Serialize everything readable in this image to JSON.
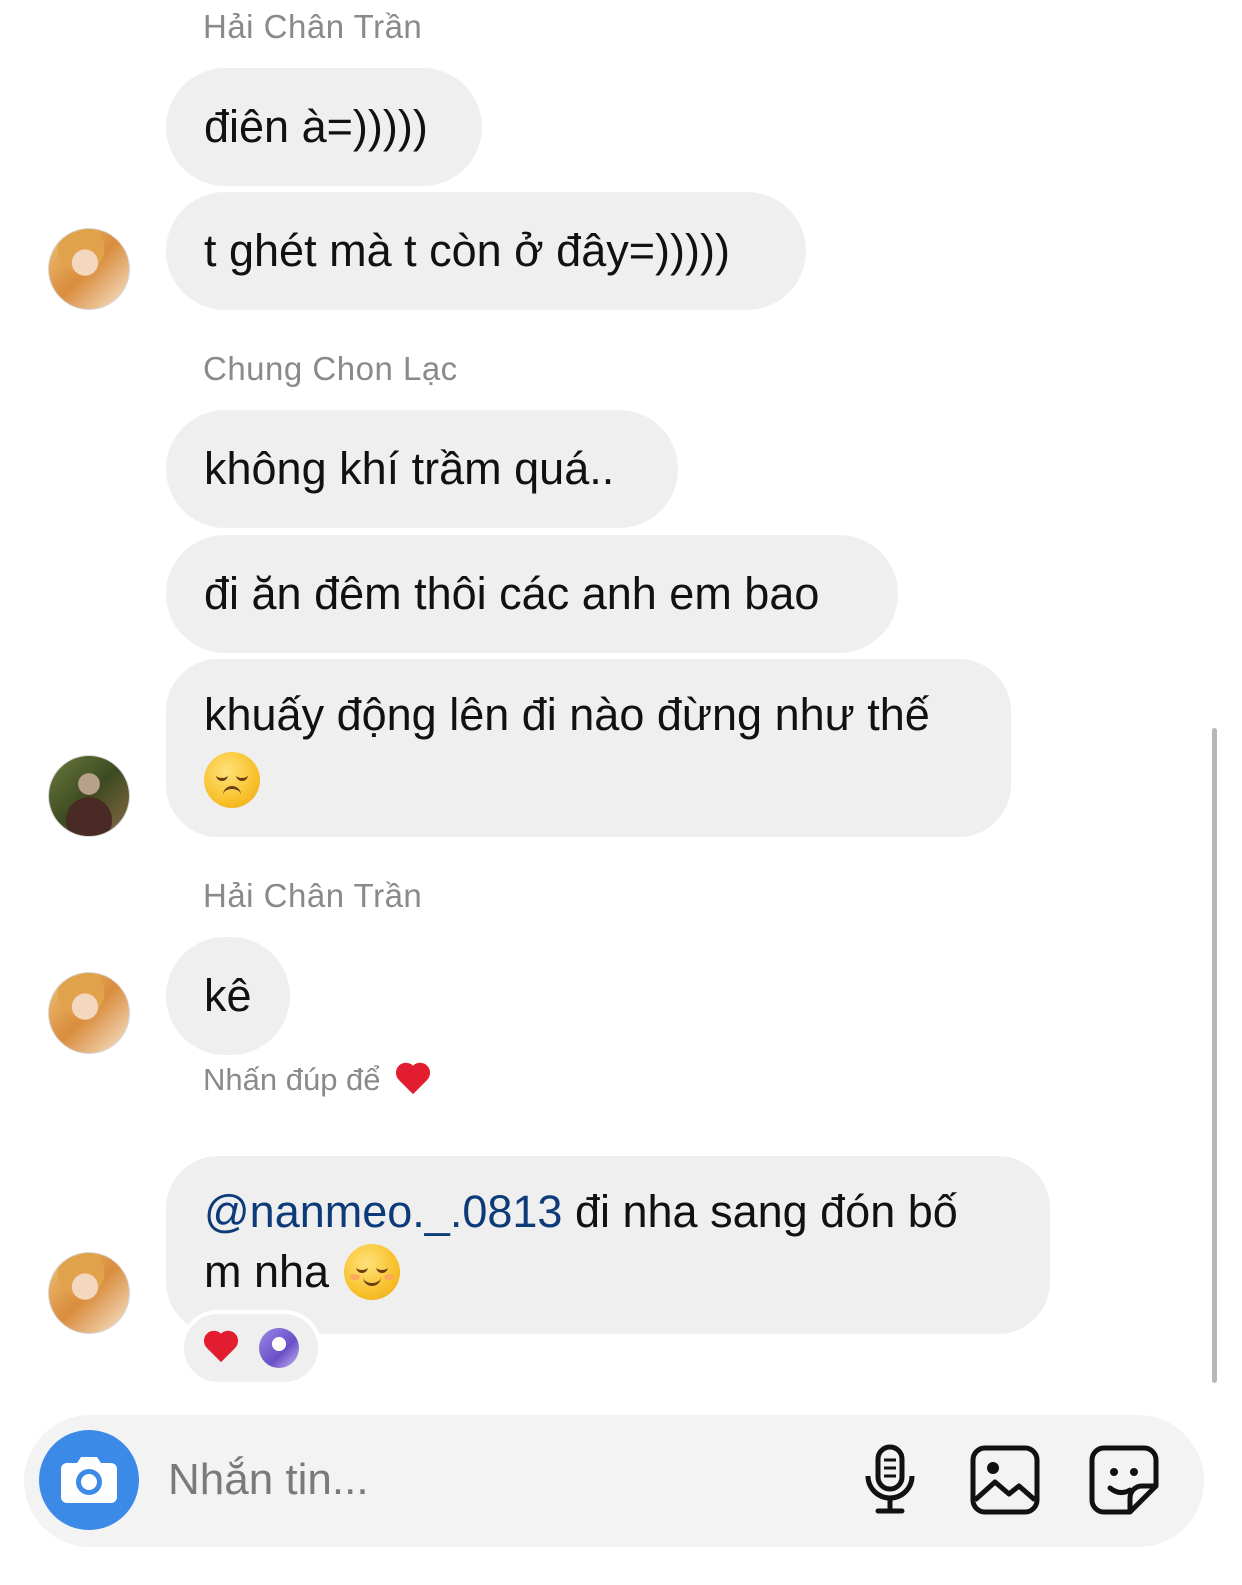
{
  "messages": [
    {
      "sender": "Hải Chân Trần",
      "bubbles": [
        "điên à=)))))",
        "t ghét mà t còn ở đây=)))))"
      ]
    },
    {
      "sender": "Chung Chon Lạc",
      "bubbles": [
        "không khí trầm quá..",
        "đi ăn đêm thôi các anh em bao",
        "khuấy động lên đi nào đừng như thế"
      ],
      "emoji_after_last": "disappointed-face"
    },
    {
      "sender": "Hải Chân Trần",
      "bubbles": [
        "kê"
      ],
      "hint": "Nhấn đúp để"
    },
    {
      "mention": "@nanmeo._.0813",
      "text_line1": " đi nha sang đón bố",
      "text_line2": "m nha",
      "emoji_after": "relieved-face",
      "reactions": [
        "red-heart",
        "reactor-avatar"
      ]
    }
  ],
  "composer": {
    "placeholder": "Nhắn tin...",
    "value": "",
    "icons": [
      "camera-icon",
      "microphone-icon",
      "gallery-icon",
      "sticker-icon"
    ],
    "camera_color": "#3b8ae8"
  },
  "colors": {
    "bubble": "#efefef",
    "sender_text": "#8a8a8a",
    "mention": "#0d3b7a",
    "heart": "#e21d2f"
  }
}
